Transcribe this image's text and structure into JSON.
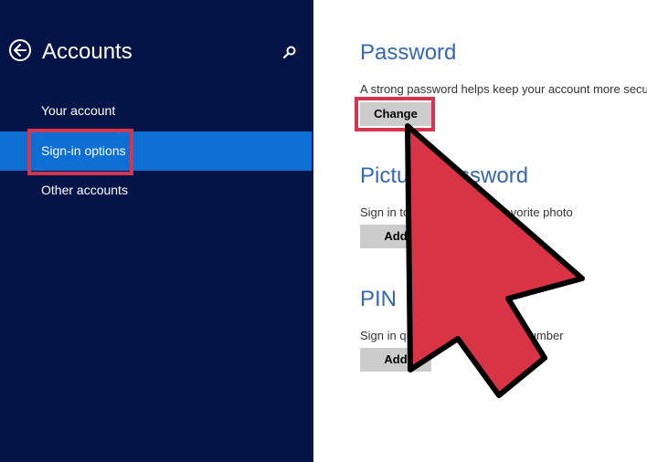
{
  "sidebar": {
    "title": "Accounts",
    "back_icon": "back-arrow-icon",
    "search_icon": "search-icon",
    "items": [
      {
        "label": "Your account",
        "active": false
      },
      {
        "label": "Sign-in options",
        "active": true
      },
      {
        "label": "Other accounts",
        "active": false
      }
    ]
  },
  "main": {
    "password": {
      "title": "Password",
      "description": "A strong password helps keep your account more secure",
      "button_label": "Change"
    },
    "picture_password": {
      "title": "Picture password",
      "description": "Sign in to your PC using a favorite photo",
      "button_label": "Add"
    },
    "pin": {
      "title": "PIN",
      "description": "Sign in quickly with a four-digit number",
      "button_label": "Add"
    }
  },
  "colors": {
    "sidebar_bg": "#041446",
    "active_item": "#0d6fd3",
    "section_title": "#3468b0",
    "highlight_box": "#d5364f",
    "pointer_fill": "#d93445"
  },
  "overlay": {
    "icon": "arrow-cursor-icon"
  }
}
